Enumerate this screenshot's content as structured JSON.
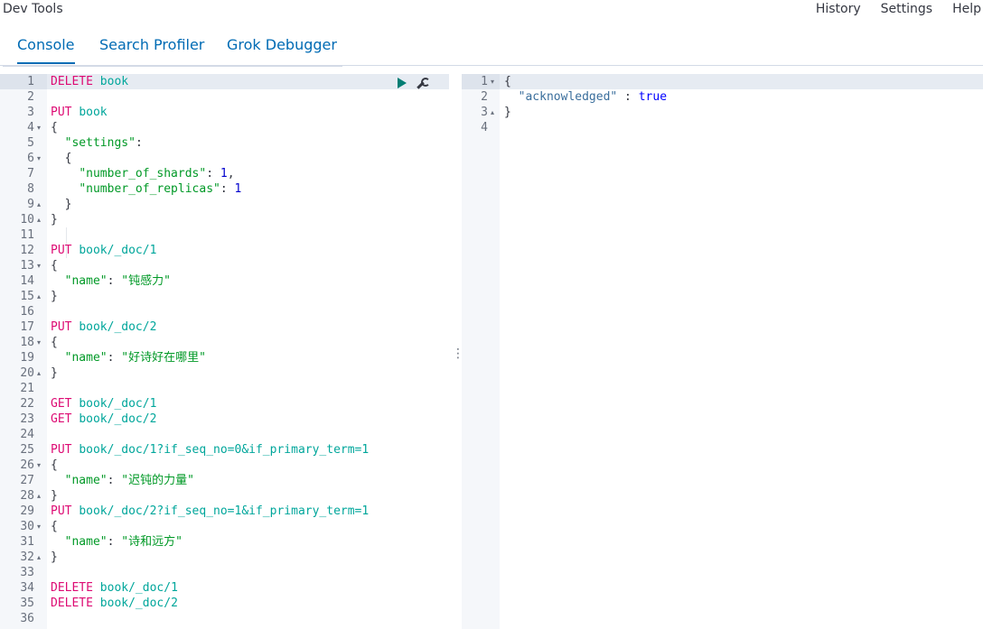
{
  "app": {
    "title": "Dev Tools"
  },
  "header_links": [
    "History",
    "Settings",
    "Help"
  ],
  "tabs": [
    "Console",
    "Search Profiler",
    "Grok Debugger"
  ],
  "request_lines": [
    [
      [
        "m",
        "DELETE "
      ],
      [
        "u",
        "book"
      ]
    ],
    [],
    [
      [
        "m",
        "PUT "
      ],
      [
        "u",
        "book"
      ]
    ],
    [
      [
        "p",
        "{"
      ]
    ],
    [
      [
        "p",
        "  "
      ],
      [
        "k",
        "\"settings\""
      ],
      [
        "p",
        ":"
      ]
    ],
    [
      [
        "p",
        "  {"
      ]
    ],
    [
      [
        "p",
        "    "
      ],
      [
        "k",
        "\"number_of_shards\""
      ],
      [
        "p",
        ": "
      ],
      [
        "n",
        "1"
      ],
      [
        "p",
        ","
      ]
    ],
    [
      [
        "p",
        "    "
      ],
      [
        "k",
        "\"number_of_replicas\""
      ],
      [
        "p",
        ": "
      ],
      [
        "n",
        "1"
      ]
    ],
    [
      [
        "p",
        "  }"
      ]
    ],
    [
      [
        "p",
        "}"
      ]
    ],
    [],
    [
      [
        "m",
        "PUT "
      ],
      [
        "u",
        "book/_doc/1"
      ]
    ],
    [
      [
        "p",
        "{"
      ]
    ],
    [
      [
        "p",
        "  "
      ],
      [
        "k",
        "\"name\""
      ],
      [
        "p",
        ": "
      ],
      [
        "s",
        "\"钝感力\""
      ]
    ],
    [
      [
        "p",
        "}"
      ]
    ],
    [],
    [
      [
        "m",
        "PUT "
      ],
      [
        "u",
        "book/_doc/2"
      ]
    ],
    [
      [
        "p",
        "{"
      ]
    ],
    [
      [
        "p",
        "  "
      ],
      [
        "k",
        "\"name\""
      ],
      [
        "p",
        ": "
      ],
      [
        "s",
        "\"好诗好在哪里\""
      ]
    ],
    [
      [
        "p",
        "}"
      ]
    ],
    [],
    [
      [
        "m",
        "GET "
      ],
      [
        "u",
        "book/_doc/1"
      ]
    ],
    [
      [
        "m",
        "GET "
      ],
      [
        "u",
        "book/_doc/2"
      ]
    ],
    [],
    [
      [
        "m",
        "PUT "
      ],
      [
        "u",
        "book/_doc/1?if_seq_no=0&if_primary_term=1"
      ]
    ],
    [
      [
        "p",
        "{"
      ]
    ],
    [
      [
        "p",
        "  "
      ],
      [
        "k",
        "\"name\""
      ],
      [
        "p",
        ": "
      ],
      [
        "s",
        "\"迟钝的力量\""
      ]
    ],
    [
      [
        "p",
        "}"
      ]
    ],
    [
      [
        "m",
        "PUT "
      ],
      [
        "u",
        "book/_doc/2?if_seq_no=1&if_primary_term=1"
      ]
    ],
    [
      [
        "p",
        "{"
      ]
    ],
    [
      [
        "p",
        "  "
      ],
      [
        "k",
        "\"name\""
      ],
      [
        "p",
        ": "
      ],
      [
        "s",
        "\"诗和远方\""
      ]
    ],
    [
      [
        "p",
        "}"
      ]
    ],
    [],
    [
      [
        "m",
        "DELETE "
      ],
      [
        "u",
        "book/_doc/1"
      ]
    ],
    [
      [
        "m",
        "DELETE "
      ],
      [
        "u",
        "book/_doc/2"
      ]
    ],
    []
  ],
  "request_folds": {
    "4": "down",
    "6": "down",
    "9": "up",
    "10": "up",
    "13": "down",
    "15": "up",
    "18": "down",
    "20": "up",
    "26": "down",
    "28": "up",
    "30": "down",
    "32": "up"
  },
  "response_lines": [
    [
      [
        "p",
        "{"
      ]
    ],
    [
      [
        "p",
        "  "
      ],
      [
        "k2",
        "\"acknowledged\""
      ],
      [
        "p",
        " : "
      ],
      [
        "b",
        "true"
      ]
    ],
    [
      [
        "p",
        "}"
      ]
    ],
    []
  ],
  "response_folds": {
    "1": "down",
    "3": "up"
  },
  "colors": {
    "method": "#dd0a73",
    "url": "#00a69b",
    "key": "#009926",
    "number": "#0000cd",
    "accent": "#006bb4"
  }
}
